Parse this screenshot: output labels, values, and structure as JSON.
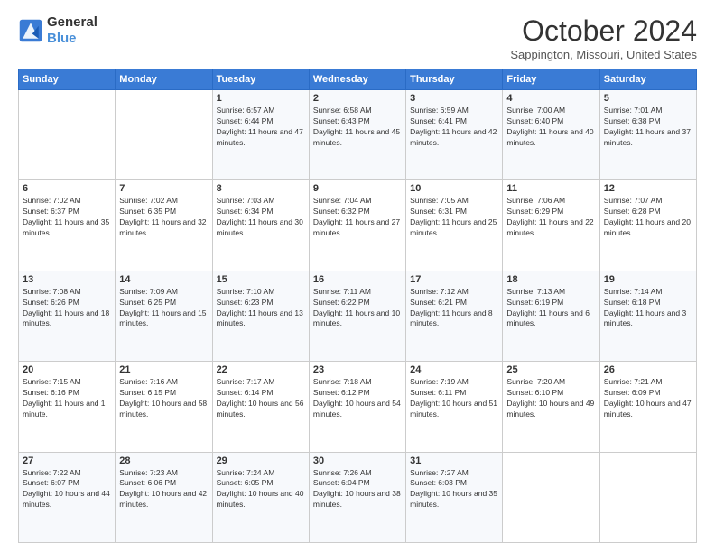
{
  "header": {
    "logo_line1": "General",
    "logo_line2": "Blue",
    "month_title": "October 2024",
    "location": "Sappington, Missouri, United States"
  },
  "days_of_week": [
    "Sunday",
    "Monday",
    "Tuesday",
    "Wednesday",
    "Thursday",
    "Friday",
    "Saturday"
  ],
  "weeks": [
    [
      {
        "day": "",
        "content": ""
      },
      {
        "day": "",
        "content": ""
      },
      {
        "day": "1",
        "content": "Sunrise: 6:57 AM\nSunset: 6:44 PM\nDaylight: 11 hours and 47 minutes."
      },
      {
        "day": "2",
        "content": "Sunrise: 6:58 AM\nSunset: 6:43 PM\nDaylight: 11 hours and 45 minutes."
      },
      {
        "day": "3",
        "content": "Sunrise: 6:59 AM\nSunset: 6:41 PM\nDaylight: 11 hours and 42 minutes."
      },
      {
        "day": "4",
        "content": "Sunrise: 7:00 AM\nSunset: 6:40 PM\nDaylight: 11 hours and 40 minutes."
      },
      {
        "day": "5",
        "content": "Sunrise: 7:01 AM\nSunset: 6:38 PM\nDaylight: 11 hours and 37 minutes."
      }
    ],
    [
      {
        "day": "6",
        "content": "Sunrise: 7:02 AM\nSunset: 6:37 PM\nDaylight: 11 hours and 35 minutes."
      },
      {
        "day": "7",
        "content": "Sunrise: 7:02 AM\nSunset: 6:35 PM\nDaylight: 11 hours and 32 minutes."
      },
      {
        "day": "8",
        "content": "Sunrise: 7:03 AM\nSunset: 6:34 PM\nDaylight: 11 hours and 30 minutes."
      },
      {
        "day": "9",
        "content": "Sunrise: 7:04 AM\nSunset: 6:32 PM\nDaylight: 11 hours and 27 minutes."
      },
      {
        "day": "10",
        "content": "Sunrise: 7:05 AM\nSunset: 6:31 PM\nDaylight: 11 hours and 25 minutes."
      },
      {
        "day": "11",
        "content": "Sunrise: 7:06 AM\nSunset: 6:29 PM\nDaylight: 11 hours and 22 minutes."
      },
      {
        "day": "12",
        "content": "Sunrise: 7:07 AM\nSunset: 6:28 PM\nDaylight: 11 hours and 20 minutes."
      }
    ],
    [
      {
        "day": "13",
        "content": "Sunrise: 7:08 AM\nSunset: 6:26 PM\nDaylight: 11 hours and 18 minutes."
      },
      {
        "day": "14",
        "content": "Sunrise: 7:09 AM\nSunset: 6:25 PM\nDaylight: 11 hours and 15 minutes."
      },
      {
        "day": "15",
        "content": "Sunrise: 7:10 AM\nSunset: 6:23 PM\nDaylight: 11 hours and 13 minutes."
      },
      {
        "day": "16",
        "content": "Sunrise: 7:11 AM\nSunset: 6:22 PM\nDaylight: 11 hours and 10 minutes."
      },
      {
        "day": "17",
        "content": "Sunrise: 7:12 AM\nSunset: 6:21 PM\nDaylight: 11 hours and 8 minutes."
      },
      {
        "day": "18",
        "content": "Sunrise: 7:13 AM\nSunset: 6:19 PM\nDaylight: 11 hours and 6 minutes."
      },
      {
        "day": "19",
        "content": "Sunrise: 7:14 AM\nSunset: 6:18 PM\nDaylight: 11 hours and 3 minutes."
      }
    ],
    [
      {
        "day": "20",
        "content": "Sunrise: 7:15 AM\nSunset: 6:16 PM\nDaylight: 11 hours and 1 minute."
      },
      {
        "day": "21",
        "content": "Sunrise: 7:16 AM\nSunset: 6:15 PM\nDaylight: 10 hours and 58 minutes."
      },
      {
        "day": "22",
        "content": "Sunrise: 7:17 AM\nSunset: 6:14 PM\nDaylight: 10 hours and 56 minutes."
      },
      {
        "day": "23",
        "content": "Sunrise: 7:18 AM\nSunset: 6:12 PM\nDaylight: 10 hours and 54 minutes."
      },
      {
        "day": "24",
        "content": "Sunrise: 7:19 AM\nSunset: 6:11 PM\nDaylight: 10 hours and 51 minutes."
      },
      {
        "day": "25",
        "content": "Sunrise: 7:20 AM\nSunset: 6:10 PM\nDaylight: 10 hours and 49 minutes."
      },
      {
        "day": "26",
        "content": "Sunrise: 7:21 AM\nSunset: 6:09 PM\nDaylight: 10 hours and 47 minutes."
      }
    ],
    [
      {
        "day": "27",
        "content": "Sunrise: 7:22 AM\nSunset: 6:07 PM\nDaylight: 10 hours and 44 minutes."
      },
      {
        "day": "28",
        "content": "Sunrise: 7:23 AM\nSunset: 6:06 PM\nDaylight: 10 hours and 42 minutes."
      },
      {
        "day": "29",
        "content": "Sunrise: 7:24 AM\nSunset: 6:05 PM\nDaylight: 10 hours and 40 minutes."
      },
      {
        "day": "30",
        "content": "Sunrise: 7:26 AM\nSunset: 6:04 PM\nDaylight: 10 hours and 38 minutes."
      },
      {
        "day": "31",
        "content": "Sunrise: 7:27 AM\nSunset: 6:03 PM\nDaylight: 10 hours and 35 minutes."
      },
      {
        "day": "",
        "content": ""
      },
      {
        "day": "",
        "content": ""
      }
    ]
  ]
}
